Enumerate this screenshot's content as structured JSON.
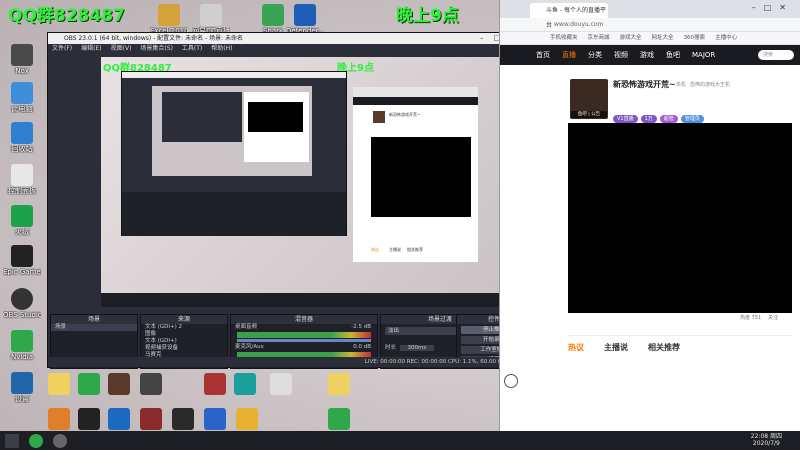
{
  "desktop": {
    "overlay_qq": "QQ群828487",
    "overlay_schedule": "晚上9点",
    "overlay_schedule_tail": "5点",
    "overlay_live": "直播",
    "icons_top": [
      "Manager...",
      "Opera",
      "Excel 2010",
      "网易CC直播",
      "Shark",
      "Defender..."
    ],
    "icons_left": [
      "Nox",
      "此电脑",
      "回收站",
      "控制面板",
      "火绒",
      "WeGame",
      "Epic Games",
      "OBS Studio",
      "Nvidia",
      "设置"
    ]
  },
  "obs": {
    "title": "OBS 23.0.1 (64 bit, windows) - 配置文件: 未命名 - 场景: 未命名",
    "menu": [
      "文件(F)",
      "编辑(E)",
      "视图(V)",
      "场景集合(S)",
      "工具(T)",
      "帮助(H)"
    ],
    "docks": {
      "scenes": {
        "title": "场景",
        "items": [
          "场景"
        ]
      },
      "sources": {
        "title": "来源",
        "items": [
          "文本 (GDI+) 2",
          "图像",
          "文本 (GDI+)",
          "视频捕获设备",
          "马赛克",
          "Cap"
        ]
      },
      "mixer": {
        "title": "混音器",
        "channels": [
          {
            "name": "桌面音频",
            "db": "-2.5 dB"
          },
          {
            "name": "麦克风/Aux",
            "db": "0.0 dB"
          }
        ]
      },
      "transitions": {
        "title": "场景过渡",
        "type": "淡出",
        "duration_label": "时长",
        "duration": "300ms"
      },
      "controls": {
        "title": "控件",
        "buttons": [
          "停止推流",
          "开始录制",
          "工作室模式",
          "设置",
          "退出"
        ]
      }
    },
    "status": "LIVE: 00:00:00   REC: 00:00:00   CPU: 1.1%, 60.00 fps"
  },
  "browser": {
    "tab_title": "斗鱼 - 每个人的直播平台",
    "url": "www.douyu.com",
    "bookmarks": [
      "手机收藏夹",
      "京东商城",
      "游戏大全",
      "网址大全",
      "360搜索",
      "主播中心",
      "游戏中心"
    ],
    "nav": [
      "首页",
      "直播",
      "分类",
      "视频",
      "游戏",
      "鱼吧",
      "MAJOR"
    ],
    "search_placeholder": "搜索",
    "streamer": {
      "name": "新恐怖游戏开荒~",
      "tag": "单机",
      "sub": "恐怖的游戏大王机",
      "id_label": "鱼吧 | 公告",
      "heat_label": "热度 751",
      "follow_label": "关注",
      "badges": [
        "V1直播",
        "1万",
        "超管",
        "管理员"
      ]
    },
    "bottom_tabs": [
      "热议",
      "主播说",
      "相关推荐"
    ],
    "colors": {
      "accent": "#ff7a00",
      "nav_bg": "#1a1b20",
      "badge": "#7e57c2"
    }
  },
  "taskbar": {
    "time": "22:08 周四",
    "date": "2020/7/9"
  }
}
